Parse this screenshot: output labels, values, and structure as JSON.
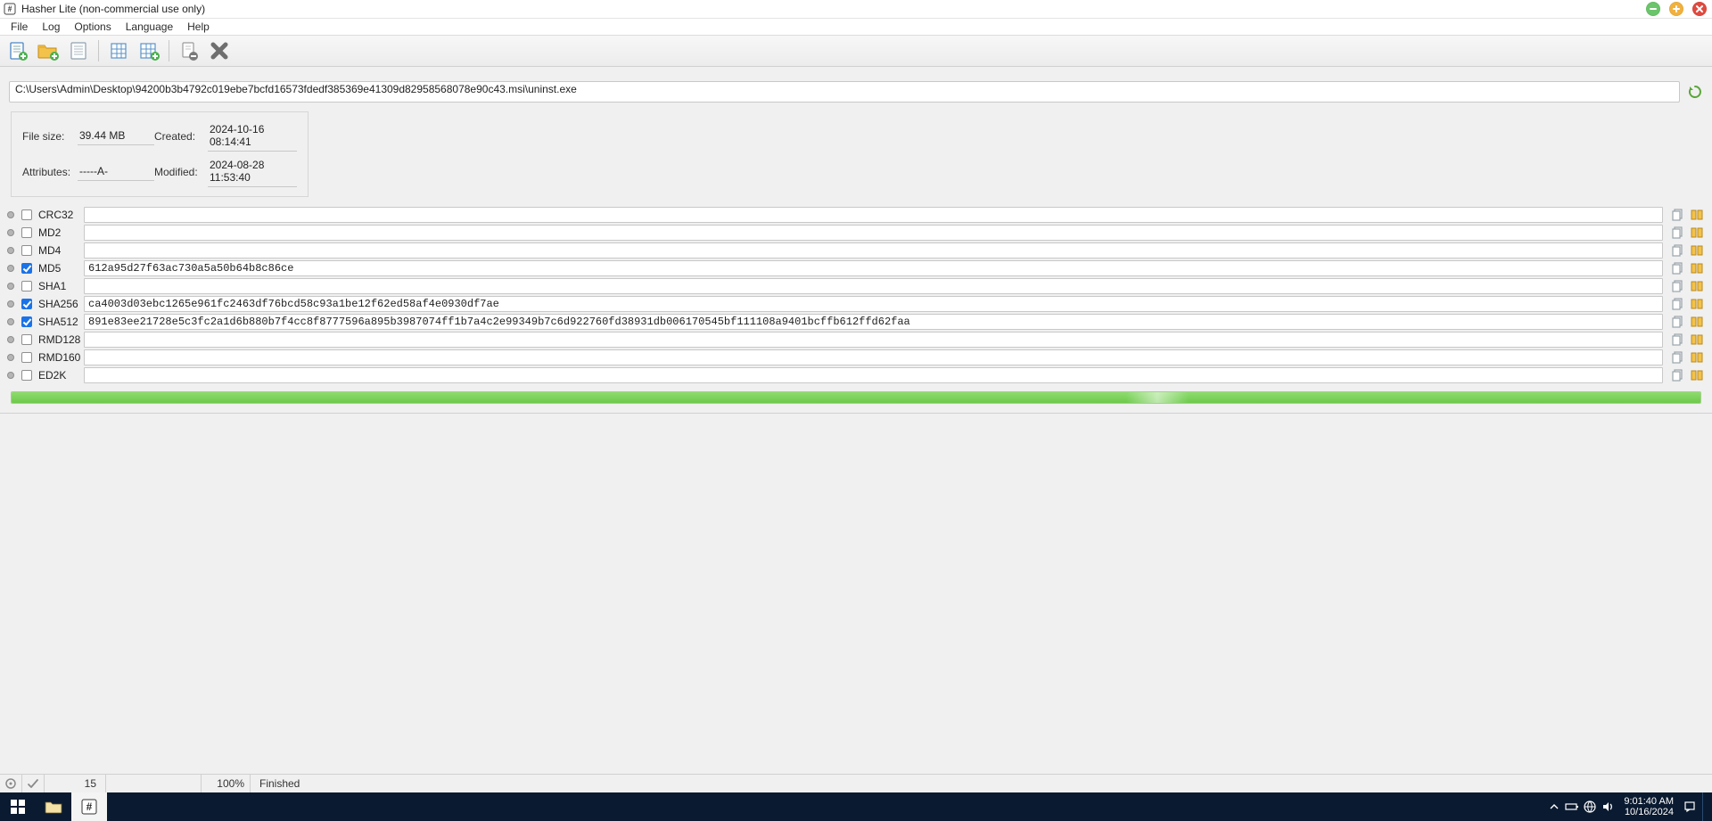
{
  "title": "Hasher Lite (non-commercial use only)",
  "menu": [
    "File",
    "Log",
    "Options",
    "Language",
    "Help"
  ],
  "path": "C:\\Users\\Admin\\Desktop\\94200b3b4792c019ebe7bcfd16573fdedf385369e41309d82958568078e90c43.msi\\uninst.exe",
  "info": {
    "file_size_label": "File size:",
    "file_size": "39.44 MB",
    "attributes_label": "Attributes:",
    "attributes": "-----A-",
    "created_label": "Created:",
    "created": "2024-10-16 08:14:41",
    "modified_label": "Modified:",
    "modified": "2024-08-28 11:53:40"
  },
  "hashes": [
    {
      "name": "CRC32",
      "checked": false,
      "value": ""
    },
    {
      "name": "MD2",
      "checked": false,
      "value": ""
    },
    {
      "name": "MD4",
      "checked": false,
      "value": ""
    },
    {
      "name": "MD5",
      "checked": true,
      "value": "612a95d27f63ac730a5a50b64b8c86ce"
    },
    {
      "name": "SHA1",
      "checked": false,
      "value": ""
    },
    {
      "name": "SHA256",
      "checked": true,
      "value": "ca4003d03ebc1265e961fc2463df76bcd58c93a1be12f62ed58af4e0930df7ae"
    },
    {
      "name": "SHA512",
      "checked": true,
      "value": "891e83ee21728e5c3fc2a1d6b880b7f4cc8f8777596a895b3987074ff1b7a4c2e99349b7c6d922760fd38931db006170545bf111108a9401bcffb612ffd62faa"
    },
    {
      "name": "RMD128",
      "checked": false,
      "value": ""
    },
    {
      "name": "RMD160",
      "checked": false,
      "value": ""
    },
    {
      "name": "ED2K",
      "checked": false,
      "value": ""
    }
  ],
  "progress": {
    "percent": 100,
    "highlight_left_pct": 66
  },
  "status": {
    "count": "15",
    "percent": "100%",
    "state": "Finished"
  },
  "clock": {
    "time": "9:01:40 AM",
    "date": "10/16/2024"
  }
}
